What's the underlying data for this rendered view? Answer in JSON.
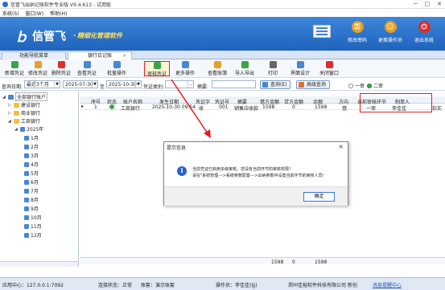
{
  "window": {
    "title": "信管飞出纳记账软件专业版 V9.4.613 - 试用版"
  },
  "menu": [
    "系统(S)",
    "窗口(W)",
    "帮助(H)"
  ],
  "banner": {
    "mark": "ｂ",
    "brand": "信管飞",
    "slogan": "・精细化管理软件",
    "buttons": [
      {
        "label": "修改密码",
        "color": "#e8a020"
      },
      {
        "label": "更换操作员",
        "color": "#e8a020"
      },
      {
        "label": "退出系统",
        "color": "#d83030"
      }
    ]
  },
  "tabs": [
    {
      "label": "功能导航菜单"
    },
    {
      "label": "银行日记账"
    }
  ],
  "toolbar": [
    {
      "label": "新增凭证",
      "color": "#3aa54a"
    },
    {
      "label": "修改凭证",
      "color": "#e0a030"
    },
    {
      "label": "删除凭证",
      "color": "#d83030"
    },
    {
      "label": "查看凭证",
      "color": "#4a86d4"
    },
    {
      "label": "批量操作",
      "color": "#4a86d4"
    },
    {
      "label": "审核凭证",
      "color": "#3aa54a"
    },
    {
      "label": "更多操作",
      "color": "#4a86d4"
    },
    {
      "label": "查看账簿",
      "color": "#e0a030"
    },
    {
      "label": "导入导出",
      "color": "#3aa54a"
    },
    {
      "label": "打印",
      "color": "#666666"
    },
    {
      "label": "界面设计",
      "color": "#4a86d4"
    },
    {
      "label": "关闭窗口",
      "color": "#d83030"
    }
  ],
  "filter": {
    "date_label": "查询日期:",
    "period": "最近3个月",
    "date_from": "2025-07-30",
    "to": "至",
    "date_to": "2025-10-30",
    "voucher_type_label": "凭证类别:",
    "summary_label": "摘要:",
    "query_btn": "查询(E)",
    "adv_btn": "高级查询",
    "radio1": "一审",
    "radio2": "二审"
  },
  "tree": {
    "root": "全部银行账户",
    "items": [
      "建设银行",
      "商业银行",
      "工商银行"
    ],
    "year": "2025年",
    "months": [
      "1月",
      "2月",
      "3月",
      "4月",
      "5月",
      "6月",
      "7月",
      "8月",
      "9月",
      "10月",
      "11月",
      "12月"
    ]
  },
  "table": {
    "columns": [
      "序号",
      "状态",
      "账户名称",
      "发生日期",
      "凭证字",
      "凭证号",
      "摘要",
      "借方金额",
      "贷方金额",
      "余额",
      "方向",
      "当前审核环节",
      "制单人"
    ],
    "rows": [
      {
        "seq": "1",
        "account": "工商银行",
        "date": "2025-10-30 09:54",
        "voucher_word": "收",
        "voucher_no": "001",
        "summary": "销售应收款",
        "debit": "1598",
        "credit": "0",
        "balance": "1598",
        "direction": "借",
        "stage": "一审",
        "maker": "李佳佳",
        "extra": "珍实"
      }
    ],
    "totals": {
      "debit": "1598",
      "credit": "0",
      "balance": "1598"
    }
  },
  "dialog": {
    "title": "提示信息",
    "line1": "当前凭证已启用多级审核，您没有当前环节的审核权限！",
    "line2": "请在\"系统管理--->系统参数配置--->出纳参数中设置当前环节的审核人员！",
    "ok": "确定"
  },
  "status": {
    "app": "应用中心：127.0.0.1:7092",
    "conn": "连接状态：正常",
    "ledger": "账套：演示账套",
    "operator": "操作员：李佳佳(ljj)",
    "company": "郑州佳裕软件科技有限公司 新创",
    "msg": "消息提醒中心"
  }
}
